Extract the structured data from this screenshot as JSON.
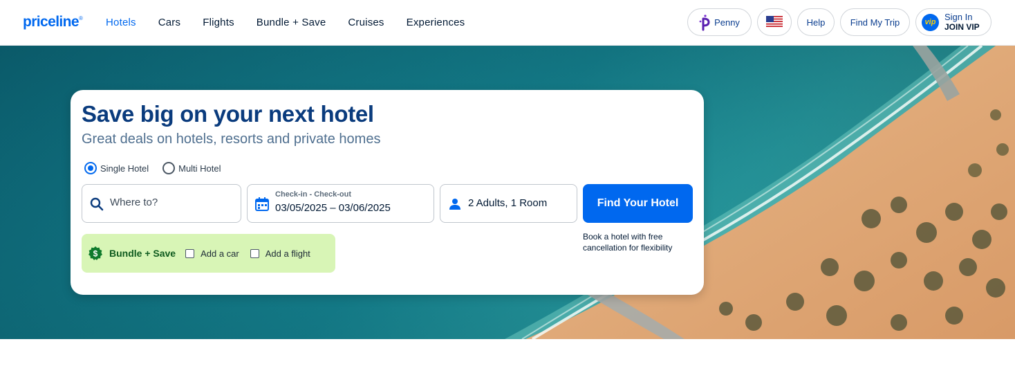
{
  "header": {
    "logo": "priceline",
    "logo_mark": "®",
    "nav": [
      {
        "label": "Hotels",
        "active": true
      },
      {
        "label": "Cars"
      },
      {
        "label": "Flights"
      },
      {
        "label": "Bundle + Save"
      },
      {
        "label": "Cruises"
      },
      {
        "label": "Experiences"
      }
    ],
    "penny_label": "Penny",
    "flag_icon": "us-flag-icon",
    "help_label": "Help",
    "find_trip_label": "Find My Trip",
    "vip_badge": "vip",
    "sign_in_label": "Sign In",
    "join_vip_label": "JOIN VIP"
  },
  "search": {
    "title": "Save big on your next hotel",
    "subtitle": "Great deals on hotels, resorts and private homes",
    "options": [
      {
        "label": "Single Hotel",
        "selected": true
      },
      {
        "label": "Multi Hotel",
        "selected": false
      }
    ],
    "where_placeholder": "Where to?",
    "dates_label": "Check-in - Check-out",
    "dates_value": "03/05/2025 – 03/06/2025",
    "guests_value": "2 Adults, 1 Room",
    "submit_label": "Find Your Hotel",
    "cancel_note": "Book a hotel with free cancellation for flexibility"
  },
  "bundle": {
    "title": "Bundle + Save",
    "add_car": "Add a car",
    "add_flight": "Add a flight"
  },
  "colors": {
    "brand_blue": "#0068ef",
    "title_navy": "#0a3b7d",
    "bundle_green": "#d8f5b6"
  }
}
